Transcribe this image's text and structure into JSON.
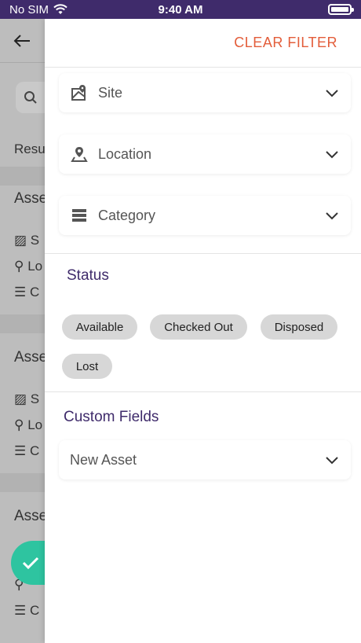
{
  "status_bar": {
    "carrier": "No SIM",
    "time": "9:40 AM"
  },
  "background": {
    "search_icon": "search-icon",
    "results_label": "Resu",
    "asset_partial_1": "Asse",
    "asset_partial_2": "Asse",
    "asset_partial_3": "Asse",
    "row_letters": [
      "S",
      "Lo",
      "C"
    ]
  },
  "drawer": {
    "clear_filter_label": "CLEAR FILTER",
    "site_label": "Site",
    "location_label": "Location",
    "category_label": "Category",
    "status_title": "Status",
    "status_chips": [
      "Available",
      "Checked Out",
      "Disposed",
      "Lost"
    ],
    "custom_fields_title": "Custom Fields",
    "custom_field_select": "New Asset"
  },
  "colors": {
    "status_bar": "#3f2b6b",
    "accent": "#e35d3a",
    "title": "#3f2b6b",
    "fab": "#2ec4a0"
  }
}
